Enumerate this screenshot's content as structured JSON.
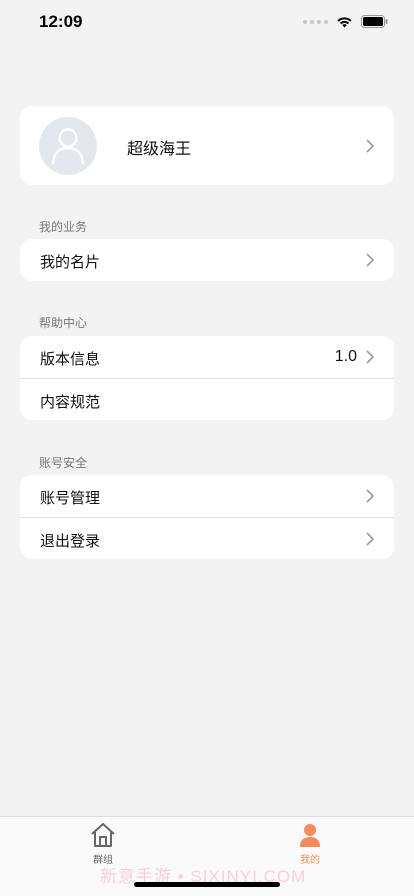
{
  "status_bar": {
    "time": "12:09"
  },
  "profile": {
    "name": "超级海王"
  },
  "sections": [
    {
      "title": "我的业务",
      "rows": [
        {
          "label": "我的名片",
          "value": "",
          "chevron": true
        }
      ]
    },
    {
      "title": "帮助中心",
      "rows": [
        {
          "label": "版本信息",
          "value": "1.0",
          "chevron": true
        },
        {
          "label": "内容规范",
          "value": "",
          "chevron": false
        }
      ]
    },
    {
      "title": "账号安全",
      "rows": [
        {
          "label": "账号管理",
          "value": "",
          "chevron": true
        },
        {
          "label": "退出登录",
          "value": "",
          "chevron": true
        }
      ]
    }
  ],
  "tab_bar": {
    "tabs": [
      {
        "label": "群组",
        "icon": "home-icon",
        "active": false
      },
      {
        "label": "我的",
        "icon": "person-icon",
        "active": true
      }
    ]
  },
  "colors": {
    "accent": "#f58b5b",
    "inactive": "#666666",
    "background": "#f3f3f3"
  },
  "watermark": "新意手游 • SIXINYI.COM"
}
